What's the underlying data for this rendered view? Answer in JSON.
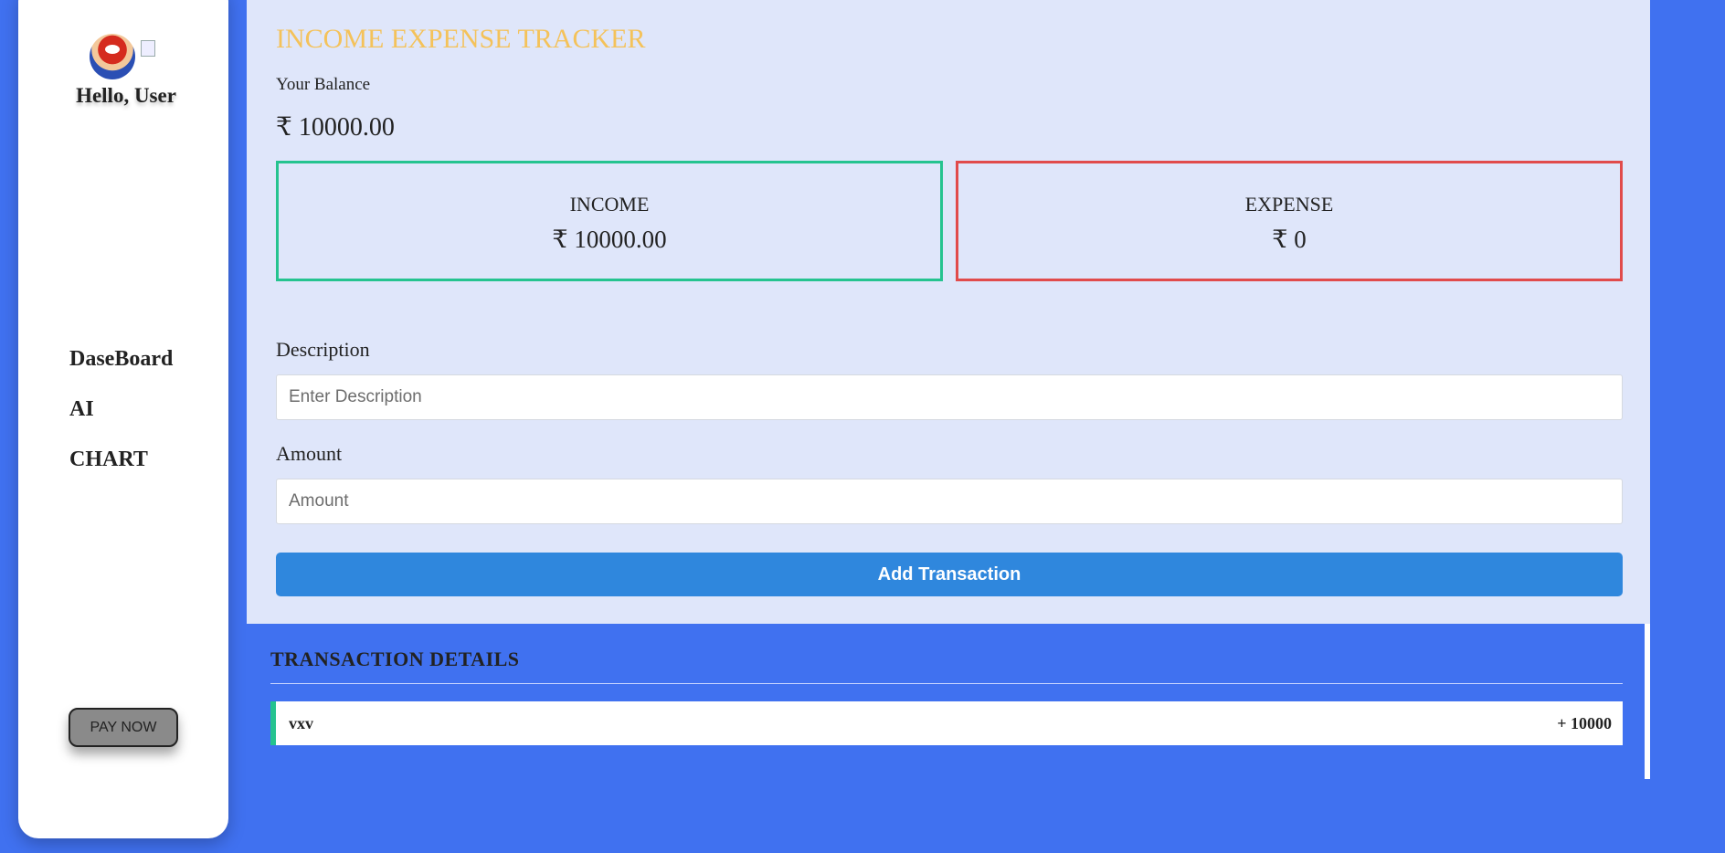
{
  "sidebar": {
    "greeting": "Hello, User",
    "nav": [
      "DaseBoard",
      "AI",
      "CHART"
    ],
    "pay_button": "PAY NOW"
  },
  "main": {
    "title": "INCOME EXPENSE TRACKER",
    "balance_label": "Your Balance",
    "balance_value": "₹ 10000.00",
    "income": {
      "label": "INCOME",
      "amount": "₹ 10000.00"
    },
    "expense": {
      "label": "EXPENSE",
      "amount": "₹ 0"
    },
    "form": {
      "description_label": "Description",
      "description_placeholder": "Enter Description",
      "description_value": "",
      "amount_label": "Amount",
      "amount_placeholder": "Amount",
      "amount_value": "",
      "submit_label": "Add Transaction"
    }
  },
  "transactions": {
    "title": "TRANSACTION DETAILS",
    "items": [
      {
        "description": "vxv",
        "amount": "+ 10000",
        "type": "income"
      }
    ]
  },
  "colors": {
    "page_bg": "#4071f0",
    "panel_bg": "#dfe6fa",
    "title": "#f4c25a",
    "income": "#25c38f",
    "expense": "#e14b4b",
    "button": "#2f87dd"
  },
  "icons": {
    "avatar": "mario-avatar-icon",
    "broken_image": "broken-image-icon"
  }
}
